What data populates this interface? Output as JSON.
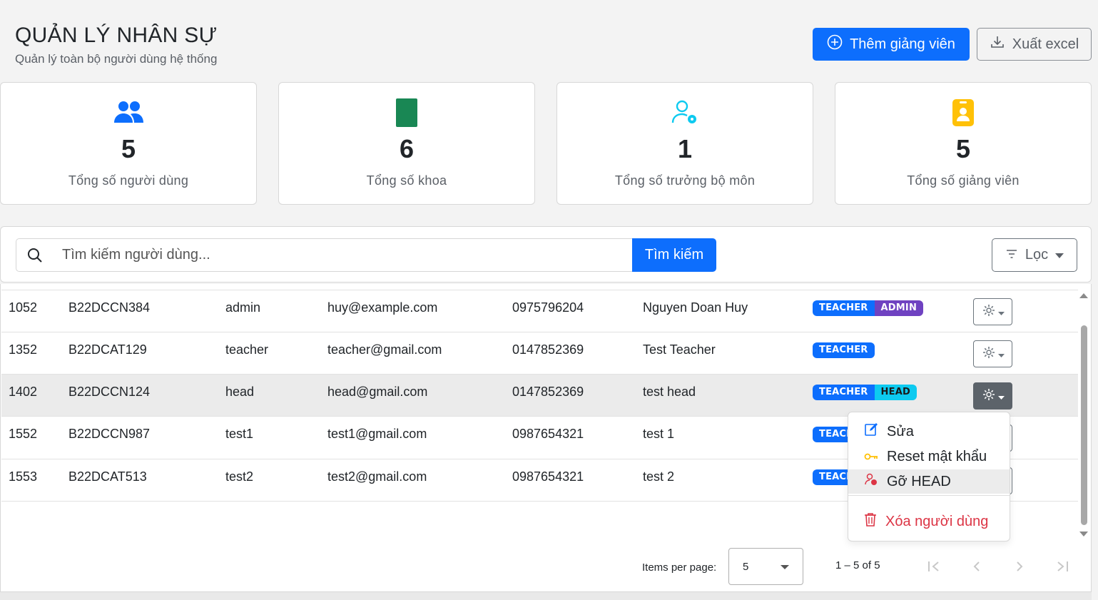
{
  "header": {
    "title": "QUẢN LÝ NHÂN SỰ",
    "subtitle": "Quản lý toàn bộ người dùng hệ thống",
    "add_button": "Thêm giảng viên",
    "export_button": "Xuất excel"
  },
  "stats": [
    {
      "icon": "users-icon",
      "color": "#0d6efd",
      "value": "5",
      "label": "Tổng số người dùng"
    },
    {
      "icon": "book-icon",
      "color": "#198754",
      "value": "6",
      "label": "Tổng số khoa"
    },
    {
      "icon": "user-gear-icon",
      "color": "#0dcaf0",
      "value": "1",
      "label": "Tổng số trưởng bộ môn"
    },
    {
      "icon": "id-badge-icon",
      "color": "#ffc107",
      "value": "5",
      "label": "Tổng số giảng viên"
    }
  ],
  "search": {
    "placeholder": "Tìm kiếm người dùng...",
    "button": "Tìm kiếm",
    "filter_button": "Lọc"
  },
  "table": {
    "rows": [
      {
        "id": "1052",
        "code": "B22DCCN384",
        "username": "admin",
        "email": "huy@example.com",
        "phone": "0975796204",
        "name": "Nguyen Doan Huy",
        "roles": [
          "TEACHER",
          "ADMIN"
        ]
      },
      {
        "id": "1352",
        "code": "B22DCAT129",
        "username": "teacher",
        "email": "teacher@gmail.com",
        "phone": "0147852369",
        "name": "Test Teacher",
        "roles": [
          "TEACHER"
        ]
      },
      {
        "id": "1402",
        "code": "B22DCCN124",
        "username": "head",
        "email": "head@gmail.com",
        "phone": "0147852369",
        "name": "test head",
        "roles": [
          "TEACHER",
          "HEAD"
        ]
      },
      {
        "id": "1552",
        "code": "B22DCCN987",
        "username": "test1",
        "email": "test1@gmail.com",
        "phone": "0987654321",
        "name": "test 1",
        "roles": [
          "TEACHER"
        ]
      },
      {
        "id": "1553",
        "code": "B22DCAT513",
        "username": "test2",
        "email": "test2@gmail.com",
        "phone": "0987654321",
        "name": "test 2",
        "roles": [
          "TEACHER"
        ]
      }
    ],
    "role_colors": {
      "TEACHER": "#0d6efd",
      "ADMIN": "#6f42c1",
      "HEAD": "#0dcaf0"
    }
  },
  "action_menu": {
    "items": [
      {
        "label": "Sửa",
        "icon": "edit-icon"
      },
      {
        "label": "Reset mật khẩu",
        "icon": "key-icon"
      },
      {
        "label": "Gỡ HEAD",
        "icon": "user-remove-icon"
      },
      {
        "label": "Xóa người dùng",
        "icon": "trash-icon"
      }
    ]
  },
  "paginator": {
    "items_per_page_label": "Items per page:",
    "page_size": "5",
    "range_label": "1 – 5 of 5"
  }
}
